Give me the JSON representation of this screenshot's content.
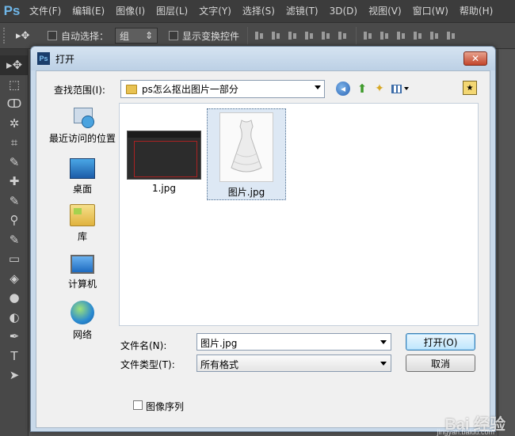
{
  "app": {
    "logo": "Ps",
    "menu": [
      "文件(F)",
      "编辑(E)",
      "图像(I)",
      "图层(L)",
      "文字(Y)",
      "选择(S)",
      "滤镜(T)",
      "3D(D)",
      "视图(V)",
      "窗口(W)",
      "帮助(H)"
    ]
  },
  "options": {
    "tool_glyph": "▸✥",
    "auto_select_label": "自动选择：",
    "auto_select_value": "组",
    "show_transform_label": "显示变换控件"
  },
  "toolbox": {
    "tools": [
      "move",
      "marquee",
      "lasso",
      "magic-wand",
      "crop",
      "eyedropper",
      "healing",
      "brush",
      "stamp",
      "history-brush",
      "eraser",
      "paint-bucket",
      "blur",
      "dodge",
      "pen",
      "type",
      "path-select"
    ],
    "glyphs": [
      "▸✥",
      "⬚",
      "ↀ",
      "✲",
      "⌗",
      "✎",
      "✚",
      "✎",
      "⚲",
      "✎",
      "▭",
      "◈",
      "●",
      "◐",
      "✒",
      "T",
      "➤"
    ]
  },
  "dialog": {
    "title": "打开",
    "close_label": "✕",
    "look_in_label": "查找范围(I):",
    "look_in_value": "ps怎么抠出图片一部分",
    "places": [
      {
        "label": "最近访问的位置",
        "icon": "recent-places-icon"
      },
      {
        "label": "桌面",
        "icon": "desktop-icon"
      },
      {
        "label": "库",
        "icon": "library-icon"
      },
      {
        "label": "计算机",
        "icon": "computer-icon"
      },
      {
        "label": "网络",
        "icon": "network-icon"
      }
    ],
    "files": [
      {
        "name": "1.jpg",
        "selected": false
      },
      {
        "name": "图片.jpg",
        "selected": true
      }
    ],
    "file_name_label": "文件名(N):",
    "file_name_value": "图片.jpg",
    "file_type_label": "文件类型(T):",
    "file_type_value": "所有格式",
    "open_button": "打开(O)",
    "cancel_button": "取消",
    "image_sequence_label": "图像序列"
  },
  "watermark": {
    "text": "Bai 经验",
    "sub": "jingyan.baidu.com"
  }
}
